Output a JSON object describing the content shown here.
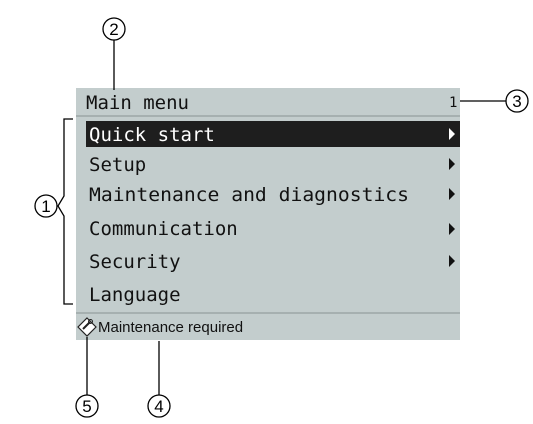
{
  "screen": {
    "title": "Main menu",
    "page_number": "1",
    "selected_index": 0,
    "menu_items": [
      {
        "label": "Quick start",
        "has_submenu": true
      },
      {
        "label": "Setup",
        "has_submenu": true
      },
      {
        "label": "Maintenance and diagnostics",
        "has_submenu": true
      },
      {
        "label": "Communication",
        "has_submenu": true
      },
      {
        "label": "Security",
        "has_submenu": true
      },
      {
        "label": "Language",
        "has_submenu": false
      }
    ],
    "status_icon": "maintenance-wrench-icon",
    "status_text": "Maintenance required"
  },
  "callouts": {
    "menu_list": "1",
    "title_line": "2",
    "page_number": "3",
    "status_text": "4",
    "status_icon": "5"
  },
  "colors": {
    "lcd_background": "#c3cdcd",
    "lcd_text": "#111111",
    "selection_bar": "#1e1e1e",
    "selection_text": "#ffffff"
  }
}
